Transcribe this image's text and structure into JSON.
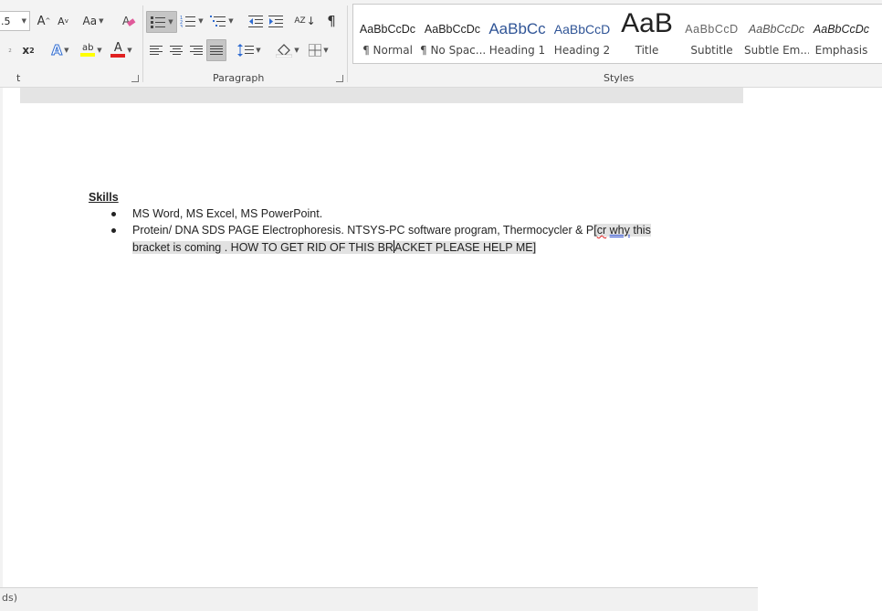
{
  "ribbon": {
    "font_group": {
      "label": "t",
      "size_value": ".5",
      "grow_font": "A",
      "shrink_font": "A",
      "change_case": "Aa",
      "superscript_base": "x",
      "superscript_exp": "2",
      "text_effects": "A",
      "highlight_letters": "ab",
      "font_color_letter": "A",
      "highlight_color": "#ffff00",
      "font_color": "#e02020"
    },
    "paragraph_group": {
      "label": "Paragraph",
      "sort_symbol": "AZ",
      "pilcrow": "¶"
    },
    "styles_group": {
      "label": "Styles",
      "items": [
        {
          "sample": "AaBbCcDc",
          "name": "¶ Normal"
        },
        {
          "sample": "AaBbCcDc",
          "name": "¶ No Spac..."
        },
        {
          "sample": "AaBbCc",
          "name": "Heading 1"
        },
        {
          "sample": "AaBbCcD",
          "name": "Heading 2"
        },
        {
          "sample": "AaB",
          "name": "Title"
        },
        {
          "sample": "AaBbCcD",
          "name": "Subtitle"
        },
        {
          "sample": "AaBbCcDc",
          "name": "Subtle Em..."
        },
        {
          "sample": "AaBbCcDc",
          "name": "Emphasis"
        }
      ]
    }
  },
  "document": {
    "heading": "Skills",
    "bullets": [
      {
        "text": "MS Word, MS Excel, MS PowerPoint."
      },
      {
        "line1_prefix": "Protein/ DNA SDS PAGE Electrophoresis. NTSYS-PC software program, Thermocycler & P",
        "line1_bracket": "[",
        "line1_misspelled": "cr",
        "line1_space": " ",
        "line1_grammar": "why",
        "line1_rest": " this",
        "line2_before_cursor": "bracket is coming . HOW TO GET RID OF THIS BR",
        "line2_after_cursor": "ACKET PLEASE HELP ME",
        "line2_bracket": "]"
      }
    ]
  },
  "statusbar": {
    "text": "ds)"
  }
}
